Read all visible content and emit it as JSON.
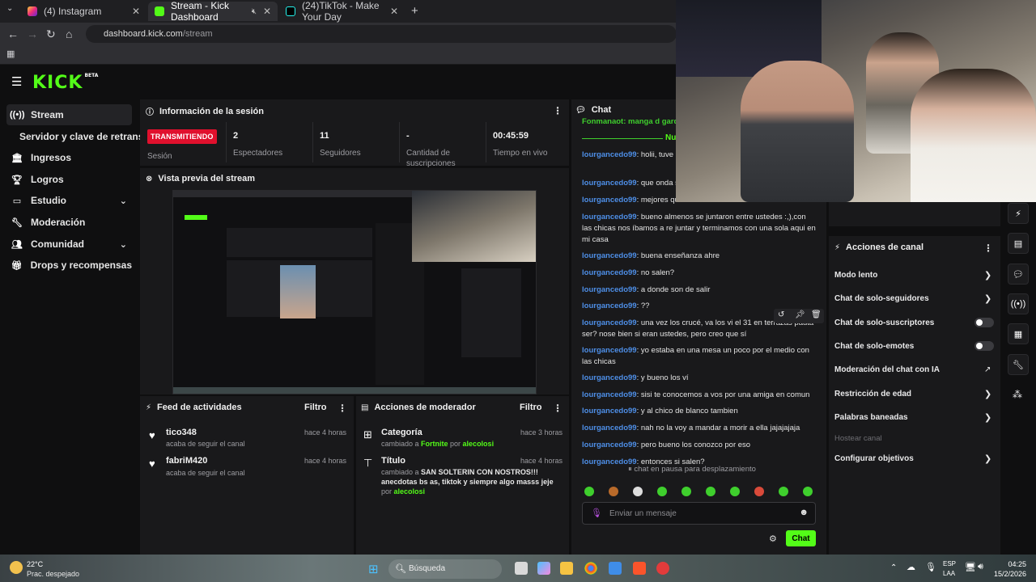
{
  "browser": {
    "tabs": [
      {
        "title": "(4) Instagram",
        "active": false
      },
      {
        "title": "Stream - Kick Dashboard",
        "active": true
      },
      {
        "title": "(24)TikTok - Make Your Day",
        "active": false
      }
    ],
    "url_host": "dashboard.kick.com",
    "url_path": "/stream"
  },
  "header": {
    "logo": "KICK",
    "beta": "BETA"
  },
  "sidebar": {
    "items": [
      {
        "label": "Stream",
        "icon": "broadcast-icon"
      },
      {
        "label": "Servidor y clave de retransm",
        "icon": ""
      },
      {
        "label": "Ingresos",
        "icon": "bank-icon"
      },
      {
        "label": "Logros",
        "icon": "trophy-icon"
      },
      {
        "label": "Estudio",
        "icon": "studio-icon"
      },
      {
        "label": "Moderación",
        "icon": "wrench-icon"
      },
      {
        "label": "Comunidad",
        "icon": "community-icon"
      },
      {
        "label": "Drops y recompensas",
        "icon": "gift-icon"
      }
    ]
  },
  "session": {
    "title": "Información de la sesión",
    "badge": "TRANSMITIENDO",
    "stats": [
      {
        "value": "",
        "label": "Sesión"
      },
      {
        "value": "2",
        "label": "Espectadores"
      },
      {
        "value": "11",
        "label": "Seguidores"
      },
      {
        "value": "-",
        "label": "Cantidad de suscripciones"
      },
      {
        "value": "00:45:59",
        "label": "Tiempo en vivo"
      }
    ]
  },
  "preview": {
    "title": "Vista previa del stream"
  },
  "activity": {
    "title": "Feed de actividades",
    "filter": "Filtro",
    "items": [
      {
        "name": "tico348",
        "desc": "acaba de seguir el canal",
        "time": "hace 4 horas"
      },
      {
        "name": "fabriM420",
        "desc": "acaba de seguir el canal",
        "time": "hace 4 horas"
      }
    ]
  },
  "modactions": {
    "title": "Acciones de moderador",
    "filter": "Filtro",
    "items": [
      {
        "name": "Categoría",
        "prefix": "cambiado a ",
        "value": "Fortnite",
        "by_word": " por ",
        "by": "alecolosi",
        "time": "hace 3 horas"
      },
      {
        "name": "Título",
        "prefix": "cambiado a ",
        "value": "SAN SOLTERIN CON NOSTROS!!! anecdotas bs as, tiktok y siempre algo masss jeje",
        "by_word": " por ",
        "by": "alecolosi",
        "time": "hace 4 horas"
      }
    ]
  },
  "chat": {
    "title": "Chat",
    "top_partial": "Fonmanaot: manga d gard",
    "new_marker": "Nu",
    "messages": [
      {
        "user": "lourgancedo99",
        "text": "holii, tuve q aqui jajajaja"
      },
      {
        "user": "lourgancedo99",
        "text": "que onda s"
      },
      {
        "user": "lourgancedo99",
        "text": "mejores qu"
      },
      {
        "user": "lourgancedo99",
        "text": "bueno almenos se juntaron entre ustedes :,),con las chicas nos íbamos a re juntar y terminamos con una sola aqui en mi casa"
      },
      {
        "user": "lourgancedo99",
        "text": "buena enseñanza ahre"
      },
      {
        "user": "lourgancedo99",
        "text": "no salen?"
      },
      {
        "user": "lourgancedo99",
        "text": "a donde son de salir"
      },
      {
        "user": "lourgancedo99",
        "text": "??"
      },
      {
        "user": "lourgancedo99",
        "text": "una vez los crucé, va los vi el 31 en terrazas pauta ser? nose bien si eran ustedes, pero creo que sí"
      },
      {
        "user": "lourgancedo99",
        "text": "yo estaba en una mesa un poco por el medio con las chicas"
      },
      {
        "user": "lourgancedo99",
        "text": "y bueno los ví"
      },
      {
        "user": "lourgancedo99",
        "text": "sisi te conocemos a vos por una amiga en comun"
      },
      {
        "user": "lourgancedo99",
        "text": "y al chico de blanco tambien"
      },
      {
        "user": "lourgancedo99",
        "text": "nah no la voy a mandar a morir a ella jajajajaja"
      },
      {
        "user": "lourgancedo99",
        "text": "pero bueno los conozco por eso"
      },
      {
        "user": "lourgancedo99",
        "text": "entonces si salen?"
      }
    ],
    "paused": "chat en pausa para desplazamiento",
    "input_placeholder": "Enviar un mensaje",
    "send_label": "Chat"
  },
  "channel_actions": {
    "title": "Acciones de canal",
    "items": [
      {
        "label": "Modo lento",
        "control": "chevron"
      },
      {
        "label": "Chat de solo-seguidores",
        "control": "chevron"
      },
      {
        "label": "Chat de solo-suscriptores",
        "control": "toggle"
      },
      {
        "label": "Chat de solo-emotes",
        "control": "toggle"
      },
      {
        "label": "Moderación del chat con IA",
        "control": "external"
      },
      {
        "label": "Restricción de edad",
        "control": "chevron"
      },
      {
        "label": "Palabras baneadas",
        "control": "chevron"
      },
      {
        "label": "Hostear canal",
        "control": "none"
      },
      {
        "label": "Configurar objetivos",
        "control": "chevron"
      }
    ]
  },
  "taskbar": {
    "temp": "22°C",
    "weather": "Prac. despejado",
    "search": "Búsqueda",
    "lang": "ESP",
    "lang2": "LAA",
    "time": "04:25",
    "date": "15/2/2026"
  }
}
